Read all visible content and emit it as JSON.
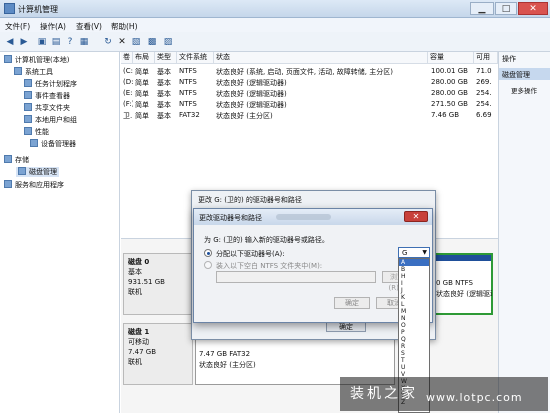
{
  "window": {
    "title": "计算机管理",
    "minimize": "▁",
    "maximize": "□",
    "close": "✕"
  },
  "menu": [
    "文件(F)",
    "操作(A)",
    "查看(V)",
    "帮助(H)"
  ],
  "toolbar_icons": [
    "back-icon",
    "forward-icon",
    "up-folder-icon",
    "console-tree-icon",
    "help-icon",
    "properties-icon",
    "refresh-icon",
    "delete-icon",
    "open-icon",
    "disk-icon",
    "settings-icon"
  ],
  "tree": [
    {
      "label": "计算机管理(本地)",
      "level": 0
    },
    {
      "label": "系统工具",
      "level": 1
    },
    {
      "label": "任务计划程序",
      "level": 2
    },
    {
      "label": "事件查看器",
      "level": 2
    },
    {
      "label": "共享文件夹",
      "level": 2
    },
    {
      "label": "本地用户和组",
      "level": 2
    },
    {
      "label": "性能",
      "level": 2
    },
    {
      "label": "设备管理器",
      "level": 2
    },
    {
      "label": "存储",
      "level": 1
    },
    {
      "label": "磁盘管理",
      "level": 2
    },
    {
      "label": "服务和应用程序",
      "level": 1
    }
  ],
  "volume_headers": [
    "卷",
    "布局",
    "类型",
    "文件系统",
    "状态",
    "容量",
    "可用"
  ],
  "volumes": [
    [
      "(C:)",
      "简单",
      "基本",
      "NTFS",
      "状态良好 (系统, 启动, 页面文件, 活动, 故障转储, 主分区)",
      "100.01 GB",
      "71.0"
    ],
    [
      "(D:)",
      "简单",
      "基本",
      "NTFS",
      "状态良好 (逻辑驱动器)",
      "280.00 GB",
      "269."
    ],
    [
      "(E:)",
      "简单",
      "基本",
      "NTFS",
      "状态良好 (逻辑驱动器)",
      "280.00 GB",
      "254."
    ],
    [
      "(F:)",
      "简单",
      "基本",
      "NTFS",
      "状态良好 (逻辑驱动器)",
      "271.50 GB",
      "254."
    ],
    [
      "卫...",
      "简单",
      "基本",
      "FAT32",
      "状态良好 (主分区)",
      "7.46 GB",
      "6.69"
    ]
  ],
  "actions": {
    "header": "操作",
    "selected": "磁盘管理",
    "more": "更多操作"
  },
  "disks": [
    {
      "name": "磁盘 0",
      "type": "基本",
      "size": "931.51 GB",
      "status": "联机"
    },
    {
      "name": "磁盘 1",
      "type": "可移动",
      "size": "7.47 GB",
      "status": "联机"
    }
  ],
  "disk0_partition": {
    "size": "0 GB NTFS",
    "status": "状态良好 (逻辑驱动器)"
  },
  "disk1_partition": {
    "size": "7.47 GB FAT32",
    "status": "状态良好 (主分区)"
  },
  "outer_dialog": {
    "title": "更改 G: (卫的) 的驱动器号和路径",
    "ok": "确定"
  },
  "inner_dialog": {
    "title": "更改驱动器号和路径",
    "prompt": "为 G: (卫的) 输入新的驱动器号或路径。",
    "option_assign": "分配以下驱动器号(A):",
    "option_mount": "装入以下空白 NTFS 文件夹中(M):",
    "browse": "浏览(R)...",
    "ok": "确定",
    "cancel": "取消",
    "close": "✕",
    "selected_letter": "G"
  },
  "letter_list": [
    "A",
    "B",
    "H",
    "I",
    "J",
    "K",
    "L",
    "M",
    "N",
    "O",
    "P",
    "Q",
    "R",
    "S",
    "T",
    "U",
    "V",
    "W",
    "X",
    "Y",
    "Z"
  ],
  "watermark": {
    "line1": "装机之家",
    "line2": "www.lotpc.com"
  },
  "colors": {
    "partition_bar": "#1f4f9a",
    "selection": "#3a6fc2",
    "close_red": "#c8403a"
  }
}
